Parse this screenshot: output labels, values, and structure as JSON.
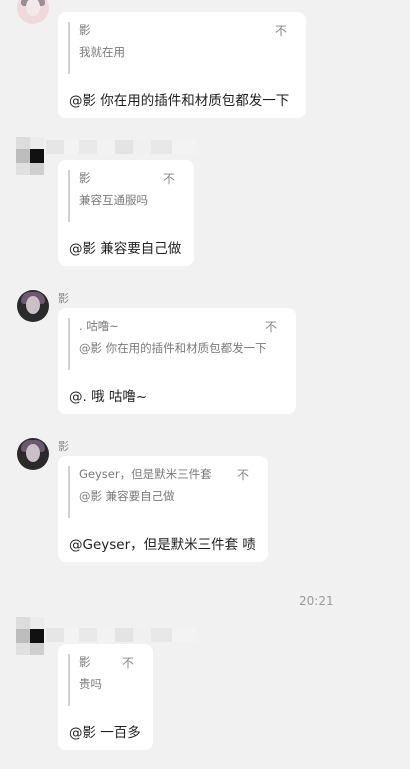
{
  "timestamp": "20:21",
  "messages": [
    {
      "sender": "",
      "quote_name": "影",
      "quote_text": "我就在用",
      "close_icon": "不",
      "text": "@影 你在用的插件和材质包都发一下"
    },
    {
      "sender": "",
      "quote_name": "影",
      "quote_text": "兼容互通服吗",
      "close_icon": "不",
      "text": "@影 兼容要自己做"
    },
    {
      "sender": "影",
      "quote_name": ". 咕噜~",
      "quote_text": "@影 你在用的插件和材质包都发一下",
      "close_icon": "不",
      "text": "@. 哦 咕噜~"
    },
    {
      "sender": "影",
      "quote_name": "Geyser，但是默米三件套",
      "quote_text": "@影 兼容要自己做",
      "close_icon": "不",
      "text": "@Geyser，但是默米三件套 啧"
    },
    {
      "sender": "",
      "quote_name": "影",
      "quote_text": "贵吗",
      "close_icon": "不",
      "text": "@影 一百多"
    }
  ]
}
